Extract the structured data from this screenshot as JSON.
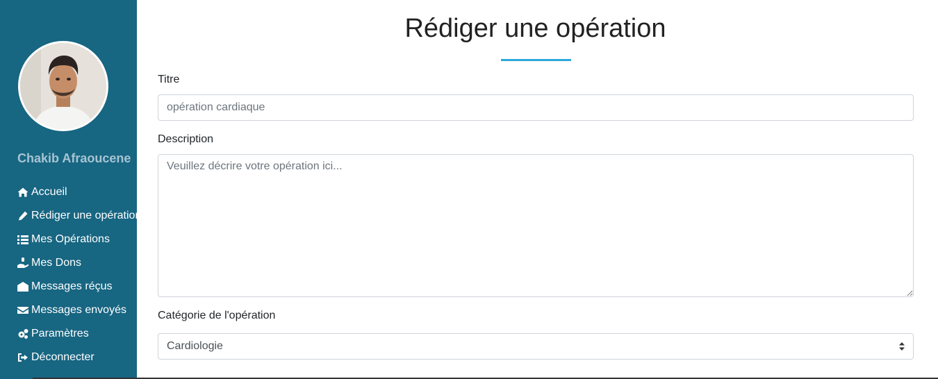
{
  "sidebar": {
    "user_name": "Chakib Afraoucene",
    "items": [
      {
        "label": "Accueil",
        "icon": "home-icon"
      },
      {
        "label": "Rédiger une opération",
        "icon": "pen-icon"
      },
      {
        "label": "Mes Opérations",
        "icon": "list-icon"
      },
      {
        "label": "Mes Dons",
        "icon": "donate-hand-icon"
      },
      {
        "label": "Messages réçus",
        "icon": "envelope-open-icon"
      },
      {
        "label": "Messages envoyés",
        "icon": "envelope-icon"
      },
      {
        "label": "Paramètres",
        "icon": "gears-icon"
      },
      {
        "label": "Déconnecter",
        "icon": "sign-out-icon"
      }
    ]
  },
  "main": {
    "title": "Rédiger une opération",
    "title_underline_color": "#2aa9d9",
    "form": {
      "titre_label": "Titre",
      "titre_placeholder": "opération cardiaque",
      "description_label": "Description",
      "description_placeholder": "Veuillez décrire votre opération ici...",
      "categorie_label": "Catégorie de l'opération",
      "categorie_value": "Cardiologie"
    }
  },
  "colors": {
    "sidebar_bg": "#176682",
    "accent": "#2aa9d9",
    "user_name": "#a7c4d3"
  }
}
